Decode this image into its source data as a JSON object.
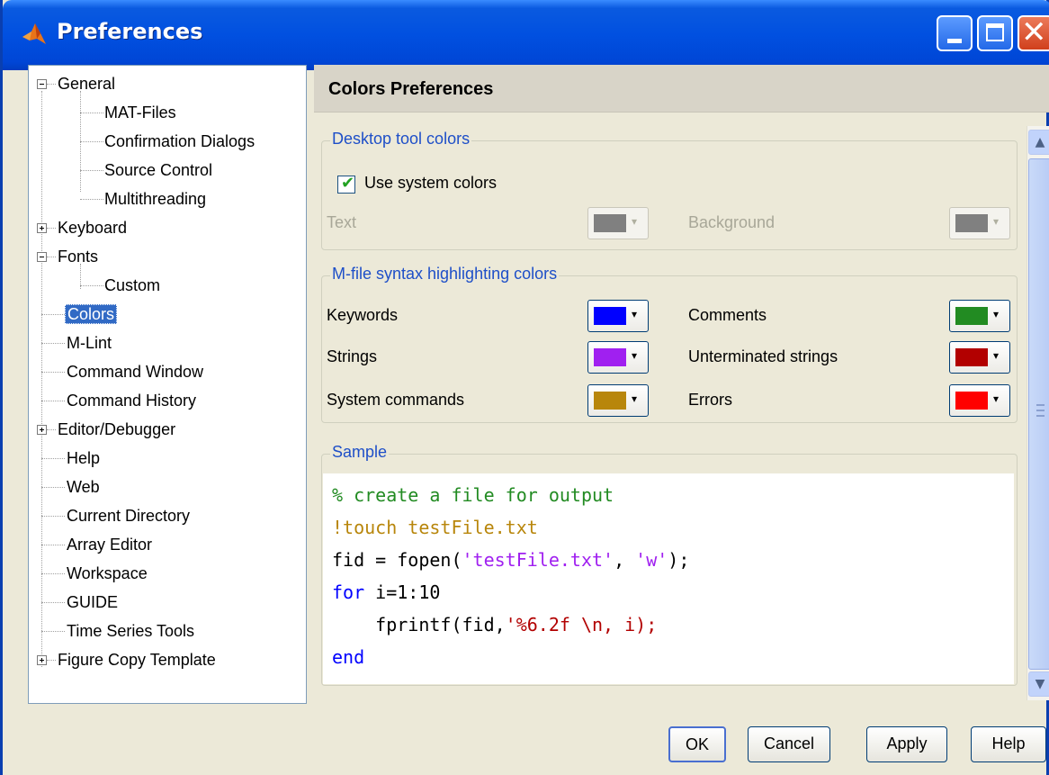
{
  "window": {
    "title": "Preferences"
  },
  "tree": [
    {
      "label": "General",
      "toggle": "minus"
    },
    {
      "label": "MAT-Files"
    },
    {
      "label": "Confirmation Dialogs"
    },
    {
      "label": "Source Control"
    },
    {
      "label": "Multithreading"
    },
    {
      "label": "Keyboard",
      "toggle": "plus"
    },
    {
      "label": "Fonts",
      "toggle": "minus"
    },
    {
      "label": "Custom"
    },
    {
      "label": "Colors",
      "selected": true
    },
    {
      "label": "M-Lint"
    },
    {
      "label": "Command Window"
    },
    {
      "label": "Command History"
    },
    {
      "label": "Editor/Debugger",
      "toggle": "plus"
    },
    {
      "label": "Help"
    },
    {
      "label": "Web"
    },
    {
      "label": "Current Directory"
    },
    {
      "label": "Array Editor"
    },
    {
      "label": "Workspace"
    },
    {
      "label": "GUIDE"
    },
    {
      "label": "Time Series Tools"
    },
    {
      "label": "Figure Copy Template",
      "toggle": "plus"
    }
  ],
  "panel": {
    "title": "Colors Preferences",
    "desktop": {
      "legend": "Desktop tool colors",
      "use_system_colors": "Use system colors",
      "use_system_checked": true,
      "text_label": "Text",
      "background_label": "Background",
      "text_color": "#808080",
      "background_color": "#808080"
    },
    "syntax": {
      "legend": "M-file syntax highlighting colors",
      "keywords": {
        "label": "Keywords",
        "color": "#0000ff"
      },
      "comments": {
        "label": "Comments",
        "color": "#228b22"
      },
      "strings": {
        "label": "Strings",
        "color": "#a020f0"
      },
      "unterminated": {
        "label": "Unterminated strings",
        "color": "#b20000"
      },
      "system_commands": {
        "label": "System commands",
        "color": "#b8860b"
      },
      "errors": {
        "label": "Errors",
        "color": "#ff0000"
      }
    },
    "sample": {
      "legend": "Sample",
      "lines": {
        "l1": "% create a file for output",
        "l2": "!touch testFile.txt",
        "l3a": "fid = fopen(",
        "l3b": "'testFile.txt'",
        "l3c": ", ",
        "l3d": "'w'",
        "l3e": ");",
        "l4a": "for",
        "l4b": " i=1:10",
        "l5a": "    fprintf(fid,",
        "l5b": "'%6.2f \\n, i);",
        "l6": "end"
      }
    }
  },
  "buttons": {
    "ok": "OK",
    "cancel": "Cancel",
    "apply": "Apply",
    "help": "Help"
  },
  "colors": {
    "comment": "#228b22",
    "system_command": "#b8860b",
    "string": "#a020f0",
    "keyword": "#0000ff",
    "unterminated": "#b20000"
  }
}
